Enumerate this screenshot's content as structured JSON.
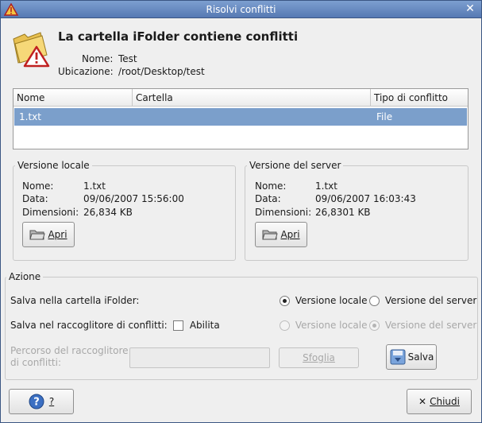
{
  "window": {
    "title": "Risolvi conflitti",
    "heading": "La cartella iFolder contiene conflitti",
    "name_label": "Nome:",
    "name_value": "Test",
    "location_label": "Ubicazione:",
    "location_value": "/root/Desktop/test"
  },
  "table": {
    "columns": [
      "Nome",
      "Cartella",
      "Tipo di conflitto"
    ],
    "rows": [
      {
        "name": "1.txt",
        "folder": "",
        "type": "File"
      }
    ]
  },
  "local_version": {
    "title": "Versione locale",
    "name_label": "Nome:",
    "name_value": "1.txt",
    "date_label": "Data:",
    "date_value": "09/06/2007 15:56:00",
    "size_label": "Dimensioni:",
    "size_value": "26,834 KB",
    "open_button": "Apri"
  },
  "server_version": {
    "title": "Versione del server",
    "name_label": "Nome:",
    "name_value": "1.txt",
    "date_label": "Data:",
    "date_value": "09/06/2007 16:03:43",
    "size_label": "Dimensioni:",
    "size_value": "26,8301 KB",
    "open_button": "Apri"
  },
  "action": {
    "title": "Azione",
    "save_in_ifolder_label": "Salva nella cartella iFolder:",
    "opt_local": "Versione locale",
    "opt_server": "Versione del server",
    "save_in_collector_label": "Salva nel raccoglitore di conflitti:",
    "enable_label": "Abilita",
    "opt_local_2": "Versione locale",
    "opt_server_2": "Versione del server",
    "path_label_1": "Percorso del raccoglitore",
    "path_label_2": "di conflitti:",
    "path_value": "",
    "browse_button": "Sfoglia",
    "save_button": "Salva",
    "selected": "local",
    "collector_enabled": false,
    "collector_selected": "server"
  },
  "footer": {
    "help_button": "?",
    "close_button": "Chiudi"
  },
  "colors": {
    "titlebar": "#6a8dc4",
    "selection": "#7b9fcb"
  }
}
